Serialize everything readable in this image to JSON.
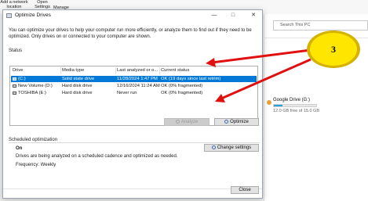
{
  "background": {
    "toolbar": [
      {
        "line1": "Add a network",
        "line2": "location"
      },
      {
        "line1": "Open",
        "line2": "Settings"
      },
      {
        "line1": "Manage",
        "line2": ""
      }
    ],
    "search_placeholder": "Search This PC",
    "drive": {
      "label": "Google Drive (G:)",
      "free": "12.0 GB free of 15.0 GB",
      "used_fraction": 0.2
    }
  },
  "dialog": {
    "title": "Optimize Drives",
    "minimize": "—",
    "maximize": "□",
    "close": "✕",
    "intro": "You can optimize your drives to help your computer run more efficiently, or analyze them to find out if they need to be optimized. Only drives on or connected to your computer are shown.",
    "status_label": "Status",
    "columns": [
      "Drive",
      "Media type",
      "Last analyzed or o...",
      "Current status"
    ],
    "drives": [
      {
        "drive": "(C:)",
        "media": "Solid state drive",
        "last": "11/28/2024 1:47 PM",
        "status": "OK (19 days since last retrim)"
      },
      {
        "drive": "New Volume (D:)",
        "media": "Hard disk drive",
        "last": "12/16/2024 11:24 AM",
        "status": "OK (0% fragmented)"
      },
      {
        "drive": "TOSHIBA (E:)",
        "media": "Hard disk drive",
        "last": "Never run",
        "status": "OK (0% fragmented)"
      }
    ],
    "analyze_label": "Analyze",
    "optimize_label": "Optimize",
    "scheduled_label": "Scheduled optimization",
    "change_settings_label": "Change settings",
    "schedule_state": "On",
    "schedule_desc": "Drives are being analyzed on a scheduled cadence and optimized as needed.",
    "frequency": "Frequency: Weekly",
    "close_label": "Close"
  },
  "annotation": {
    "badge_number": "3",
    "badge_fill": "#ffe600",
    "badge_ring": "#d4b200",
    "arrow_color": "#e01010"
  }
}
